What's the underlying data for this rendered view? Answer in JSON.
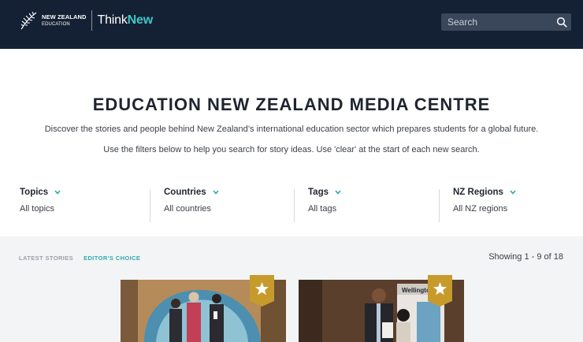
{
  "header": {
    "logo_line1": "NEW ZEALAND",
    "logo_line2": "EDUCATION",
    "brand_think": "Think",
    "brand_new": "New",
    "search_placeholder": "Search"
  },
  "hero": {
    "title": "EDUCATION NEW ZEALAND MEDIA CENTRE",
    "intro_1": "Discover the stories and people behind New Zealand’s international education sector which prepares students for a global future.",
    "intro_2": "Use the filters below to help you search for story ideas. Use 'clear' at the start of each new search."
  },
  "filters": [
    {
      "label": "Topics",
      "value": "All topics"
    },
    {
      "label": "Countries",
      "value": "All countries"
    },
    {
      "label": "Tags",
      "value": "All tags"
    },
    {
      "label": "NZ Regions",
      "value": "All NZ regions"
    }
  ],
  "stories": {
    "tab_latest": "LATEST STORIES",
    "tab_editor": "EDITOR'S CHOICE",
    "showing": "Showing 1 - 9 of 18",
    "card2_banner": "WellingtonNZ"
  },
  "colors": {
    "header_bg": "#142033",
    "accent_teal": "#2fa9b0",
    "brand_new": "#3fc7c6",
    "badge_gold": "#c79a2c"
  },
  "icons": [
    "fern-icon",
    "search-icon",
    "chevron-down-icon",
    "star-icon"
  ]
}
